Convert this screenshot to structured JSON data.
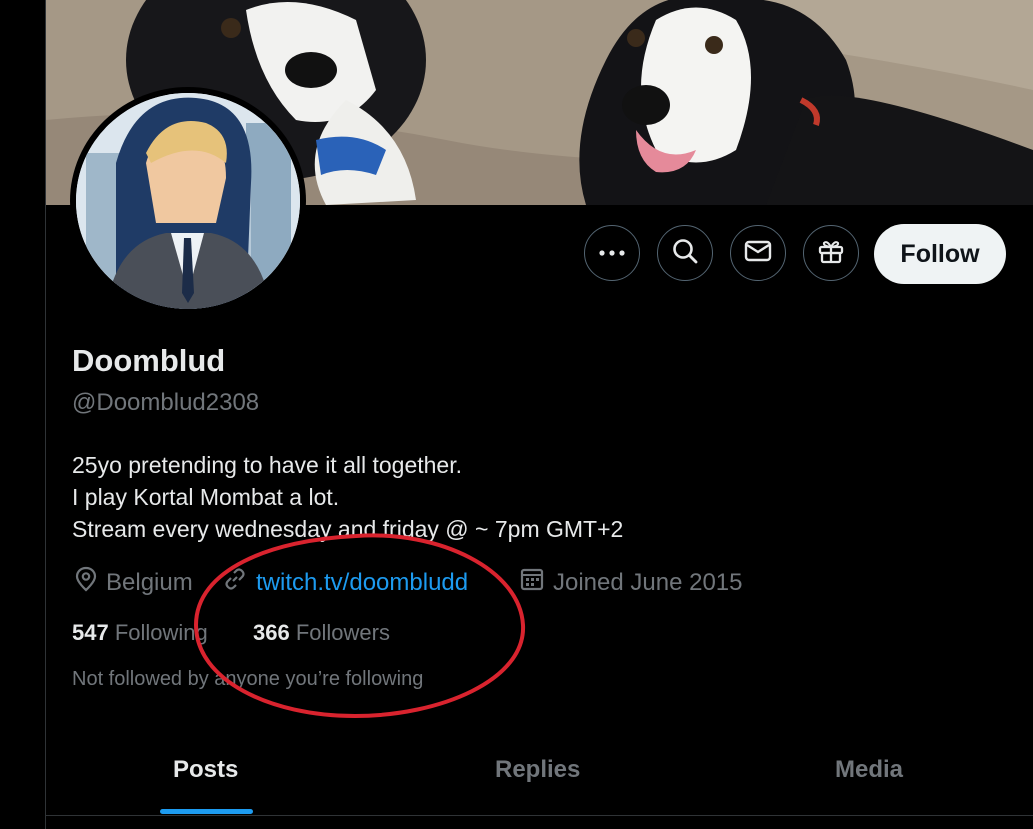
{
  "profile": {
    "name": "Doomblud",
    "handle": "@Doomblud2308",
    "bio": [
      "25yo pretending to have it all together.",
      "I play Kortal Mombat a lot.",
      "Stream every wednesday and friday @ ~ 7pm GMT+2"
    ],
    "location": "Belgium",
    "website": "twitch.tv/doombludd",
    "joined": "Joined June 2015",
    "following_count": "547",
    "following_label": "Following",
    "followers_count": "366",
    "followers_label": "Followers",
    "not_followed_text": "Not followed by anyone you’re following"
  },
  "actions": {
    "more_icon": "more-icon",
    "search_icon": "search-icon",
    "message_icon": "mail-icon",
    "gift_icon": "gift-icon",
    "follow_label": "Follow"
  },
  "tabs": [
    {
      "label": "Posts",
      "active": true
    },
    {
      "label": "Replies",
      "active": false
    },
    {
      "label": "Media",
      "active": false
    }
  ],
  "colors": {
    "accent": "#1d9bf0",
    "annotation_circle": "#d9232e",
    "background": "#000000",
    "secondary_text": "#71767b"
  }
}
